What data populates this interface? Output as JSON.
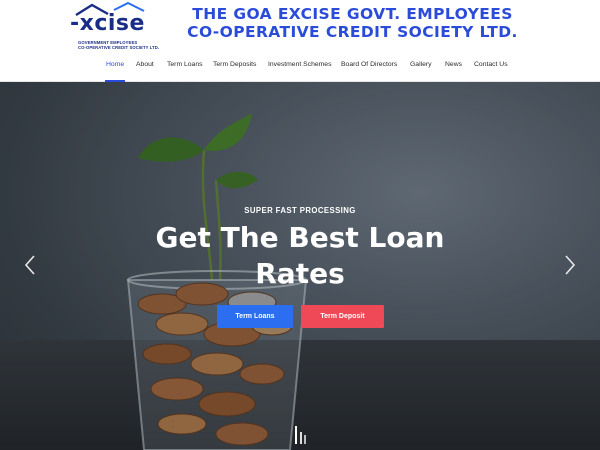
{
  "logo": {
    "word": "-xcise",
    "sub_line1": "GOVERNMENT EMPLOYEES",
    "sub_line2": "CO-OPERATIVE CREDIT SOCIETY LTD."
  },
  "org": {
    "title_line1": "THE GOA EXCISE GOVT. EMPLOYEES",
    "title_line2": "CO-OPERATIVE CREDIT SOCIETY LTD."
  },
  "nav": {
    "items": [
      {
        "label": "Home",
        "active": true
      },
      {
        "label": "About"
      },
      {
        "label": "Term Loans"
      },
      {
        "label": "Term Deposits"
      },
      {
        "label": "Investment Schemes"
      },
      {
        "label": "Board Of Directors"
      },
      {
        "label": "Gallery"
      },
      {
        "label": "News"
      },
      {
        "label": "Contact Us"
      }
    ]
  },
  "hero": {
    "kicker": "SUPER FAST PROCESSING",
    "heading_line1": "Get The Best Loan",
    "heading_line2": "Rates",
    "primary_button": "Term Loans",
    "secondary_button": "Term Deposit"
  },
  "colors": {
    "brand_blue": "#2b4bd9",
    "logo_navy": "#1a2d86",
    "button_blue": "#2b6ff0",
    "button_red": "#ef4857"
  },
  "icons": {
    "prev": "chevron-left-icon",
    "next": "chevron-right-icon",
    "scroll": "scroll-indicator-icon"
  }
}
